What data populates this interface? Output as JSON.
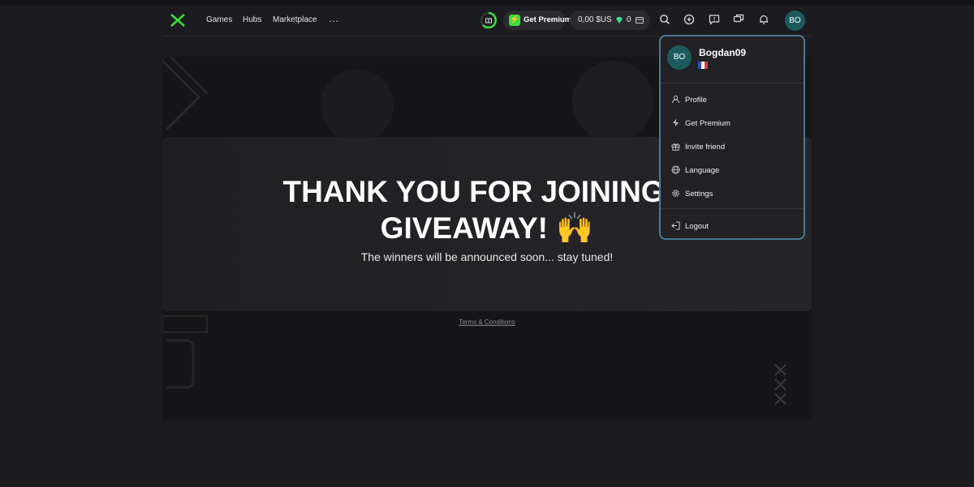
{
  "nav": {
    "links": [
      "Games",
      "Hubs",
      "Marketplace"
    ],
    "more": "...",
    "premium_label": "Get Premium",
    "balance": "0,00 $US",
    "gems": "0",
    "avatar_initials": "BO"
  },
  "hero": {
    "title_line1": "THANK YOU FOR JOINING T",
    "title_line2": "GIVEAWAY! 🙌",
    "subtitle": "The winners will be announced soon... stay tuned!",
    "terms": "Terms & Conditions"
  },
  "dropdown": {
    "avatar_initials": "BO",
    "username": "Bogdan09",
    "items": [
      {
        "label": "Profile",
        "icon": "user-icon"
      },
      {
        "label": "Get Premium",
        "icon": "bolt-icon"
      },
      {
        "label": "Invite friend",
        "icon": "gift-icon"
      },
      {
        "label": "Language",
        "icon": "globe-icon"
      },
      {
        "label": "Settings",
        "icon": "gear-icon"
      }
    ],
    "logout": "Logout"
  },
  "colors": {
    "accent_green": "#3ddc3d",
    "avatar_bg": "#1d5a5e",
    "dropdown_border": "#4a7896"
  }
}
